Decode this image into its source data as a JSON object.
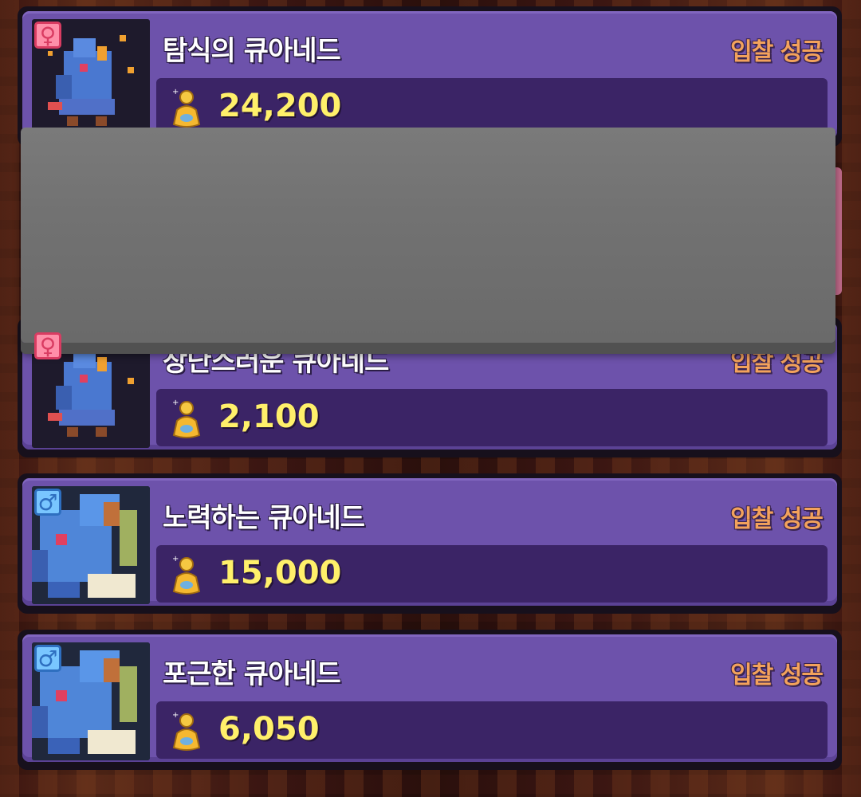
{
  "listings": [
    {
      "gender": "female",
      "gender_symbol": "♀",
      "portrait_icon": "dragon-portrait-icon",
      "name": "탐식의 큐아네드",
      "status": "입찰 성공",
      "price": "24,200",
      "currency_icon": "coin-pouch-icon"
    },
    {
      "gender": "female",
      "gender_symbol": "♀",
      "portrait_icon": "dragon-portrait-icon",
      "name": "장난스러운 큐아네드",
      "status": "입찰 성공",
      "price": "2,100",
      "currency_icon": "coin-pouch-icon"
    },
    {
      "gender": "male",
      "gender_symbol": "♂",
      "portrait_icon": "dragon-portrait-icon",
      "name": "노력하는 큐아네드",
      "status": "입찰 성공",
      "price": "15,000",
      "currency_icon": "coin-pouch-icon"
    },
    {
      "gender": "male",
      "gender_symbol": "♂",
      "portrait_icon": "dragon-portrait-icon",
      "name": "포근한 큐아네드",
      "status": "입찰 성공",
      "price": "6,050",
      "currency_icon": "coin-pouch-icon"
    }
  ],
  "colors": {
    "card": "#6d52ab",
    "price_bar": "#3b2466",
    "price_text": "#fff06a",
    "status_text": "#f3a25c",
    "female_badge": "#ff8fa9",
    "male_badge": "#79c6ff"
  }
}
